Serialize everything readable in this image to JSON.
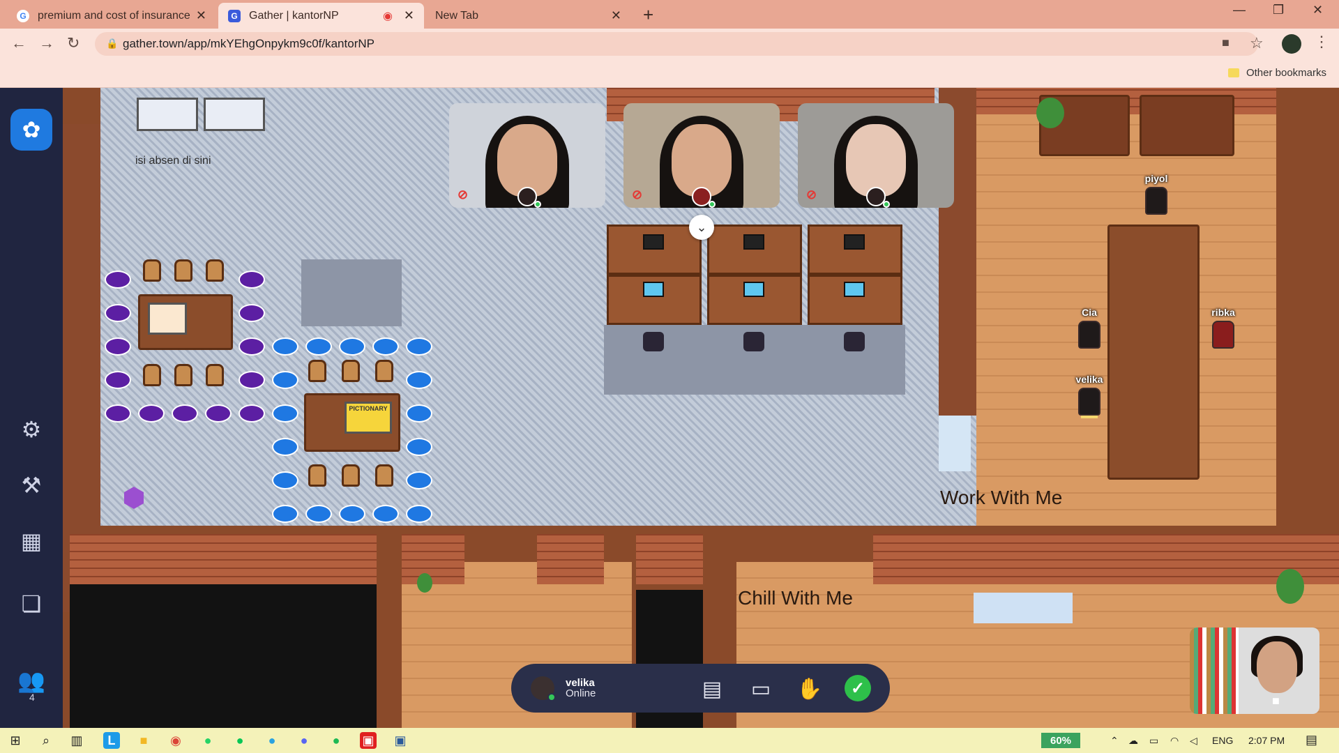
{
  "browser": {
    "tabs": [
      {
        "title": "premium and cost of insurance -",
        "favicon": "G"
      },
      {
        "title": "Gather | kantorNP",
        "favicon": "G"
      },
      {
        "title": "New Tab",
        "favicon": ""
      }
    ],
    "url": "gather.town/app/mkYEhgOnpykm9c0f/kantorNP",
    "other_bookmarks": "Other bookmarks"
  },
  "rail": {
    "online_count": "4"
  },
  "map": {
    "sign_absen": "isi absen di sini",
    "label_work": "Work With Me",
    "label_chill": "Chill With Me",
    "board_pictionary": "PICTIONARY",
    "players": [
      {
        "name": "piyol"
      },
      {
        "name": "Cia"
      },
      {
        "name": "ribka"
      },
      {
        "name": "velika"
      }
    ]
  },
  "control_bar": {
    "user_name": "velika",
    "user_status": "Online"
  },
  "taskbar": {
    "battery": "60%",
    "language": "ENG",
    "time": "2:07 PM"
  },
  "colors": {
    "tab_strip": "#e8a793",
    "rail": "#202540",
    "accent_blue": "#1f7ae0",
    "status_green": "#2ec04a"
  }
}
